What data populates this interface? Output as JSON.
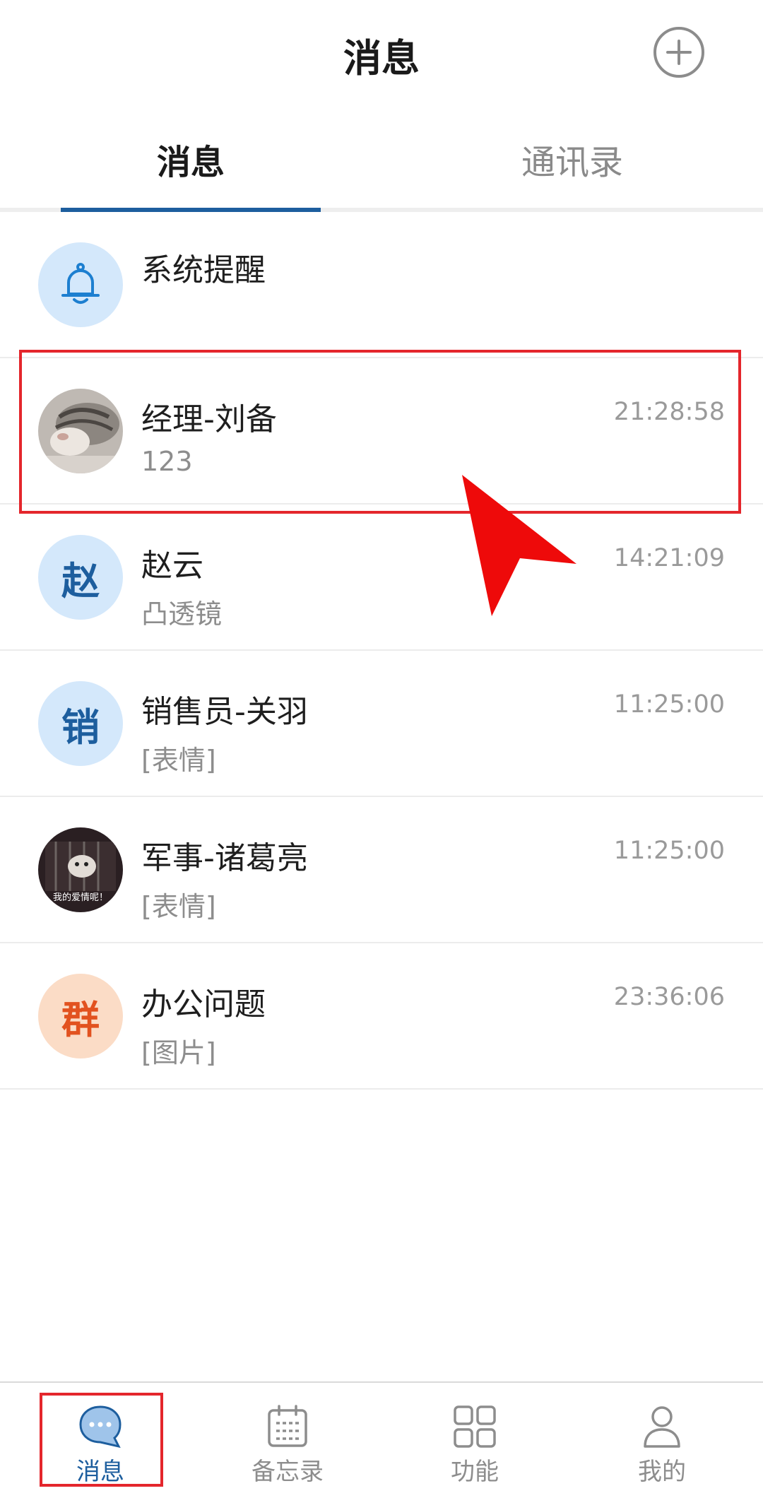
{
  "header": {
    "title": "消息",
    "add_icon": "plus-circle-icon"
  },
  "tabs": [
    {
      "label": "消息",
      "active": true
    },
    {
      "label": "通讯录",
      "active": false
    }
  ],
  "conversations": [
    {
      "name": "系统提醒",
      "preview": "",
      "time": "",
      "avatar": "bell-icon"
    },
    {
      "name": "经理-刘备",
      "preview": "123",
      "time": "21:28:58",
      "avatar": "cat-photo"
    },
    {
      "name": "赵云",
      "preview": "凸透镜",
      "time": "14:21:09",
      "avatar_text": "赵"
    },
    {
      "name": "销售员-关羽",
      "preview": "[表情]",
      "time": "11:25:00",
      "avatar_text": "销"
    },
    {
      "name": "军事-诸葛亮",
      "preview": "[表情]",
      "time": "11:25:00",
      "avatar_caption": "我的爱情呢！"
    },
    {
      "name": "办公问题",
      "preview": "[图片]",
      "time": "23:36:06",
      "avatar_text": "群"
    }
  ],
  "bottom_nav": [
    {
      "label": "消息",
      "icon": "chat-bubble-icon",
      "active": true
    },
    {
      "label": "备忘录",
      "icon": "calendar-icon",
      "active": false
    },
    {
      "label": "功能",
      "icon": "grid-icon",
      "active": false
    },
    {
      "label": "我的",
      "icon": "person-icon",
      "active": false
    }
  ],
  "colors": {
    "accent": "#1d5e9e",
    "highlight": "#e4262c",
    "group_avatar": "#e2521f"
  }
}
